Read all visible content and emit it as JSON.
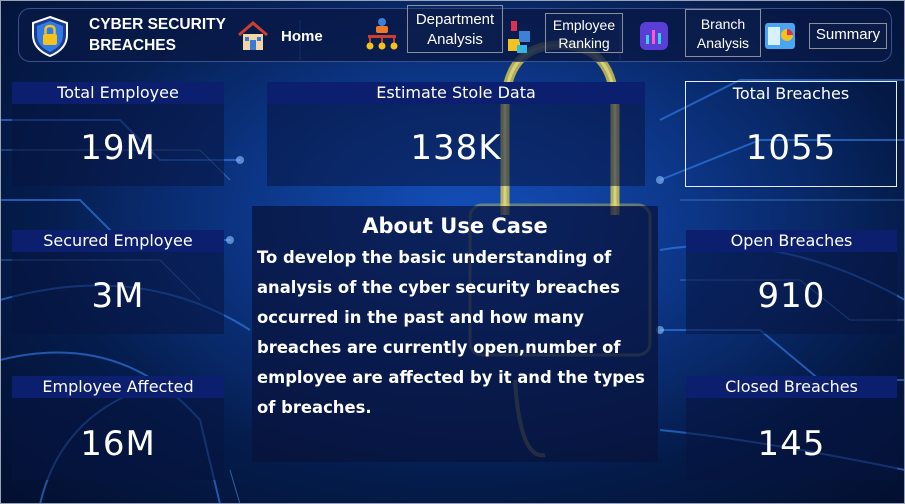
{
  "header": {
    "title": "CYBER SECURITY BREACHES",
    "nav": {
      "home": "Home",
      "department": "Department Analysis",
      "employee": "Employee Ranking",
      "branch": "Branch Analysis",
      "summary": "Summary"
    },
    "icons": {
      "logo": "shield-lock-icon",
      "home": "house-icon",
      "department": "org-chart-icon",
      "employee": "blocks-icon",
      "branch": "bar-chart-icon",
      "summary": "dashboard-report-icon"
    }
  },
  "kpis": {
    "total_employee": {
      "label": "Total Employee",
      "value": "19M"
    },
    "estimate_stole_data": {
      "label": "Estimate Stole Data",
      "value": "138K"
    },
    "total_breaches": {
      "label": "Total Breaches",
      "value": "1055"
    },
    "secured_employee": {
      "label": "Secured Employee",
      "value": "3M"
    },
    "open_breaches": {
      "label": "Open Breaches",
      "value": "910"
    },
    "employee_affected": {
      "label": "Employee Affected",
      "value": "16M"
    },
    "closed_breaches": {
      "label": "Closed Breaches",
      "value": "145"
    }
  },
  "about": {
    "title": "About Use Case",
    "text": "To develop the basic understanding of analysis of the cyber security breaches occurred in the past and how many breaches are currently open,number of employee are affected by it and the types of breaches."
  },
  "colors": {
    "background": "#062466",
    "label_bar": "#0c1f6e",
    "circuit": "#3a8dff",
    "padlock": "#e8d44a"
  }
}
